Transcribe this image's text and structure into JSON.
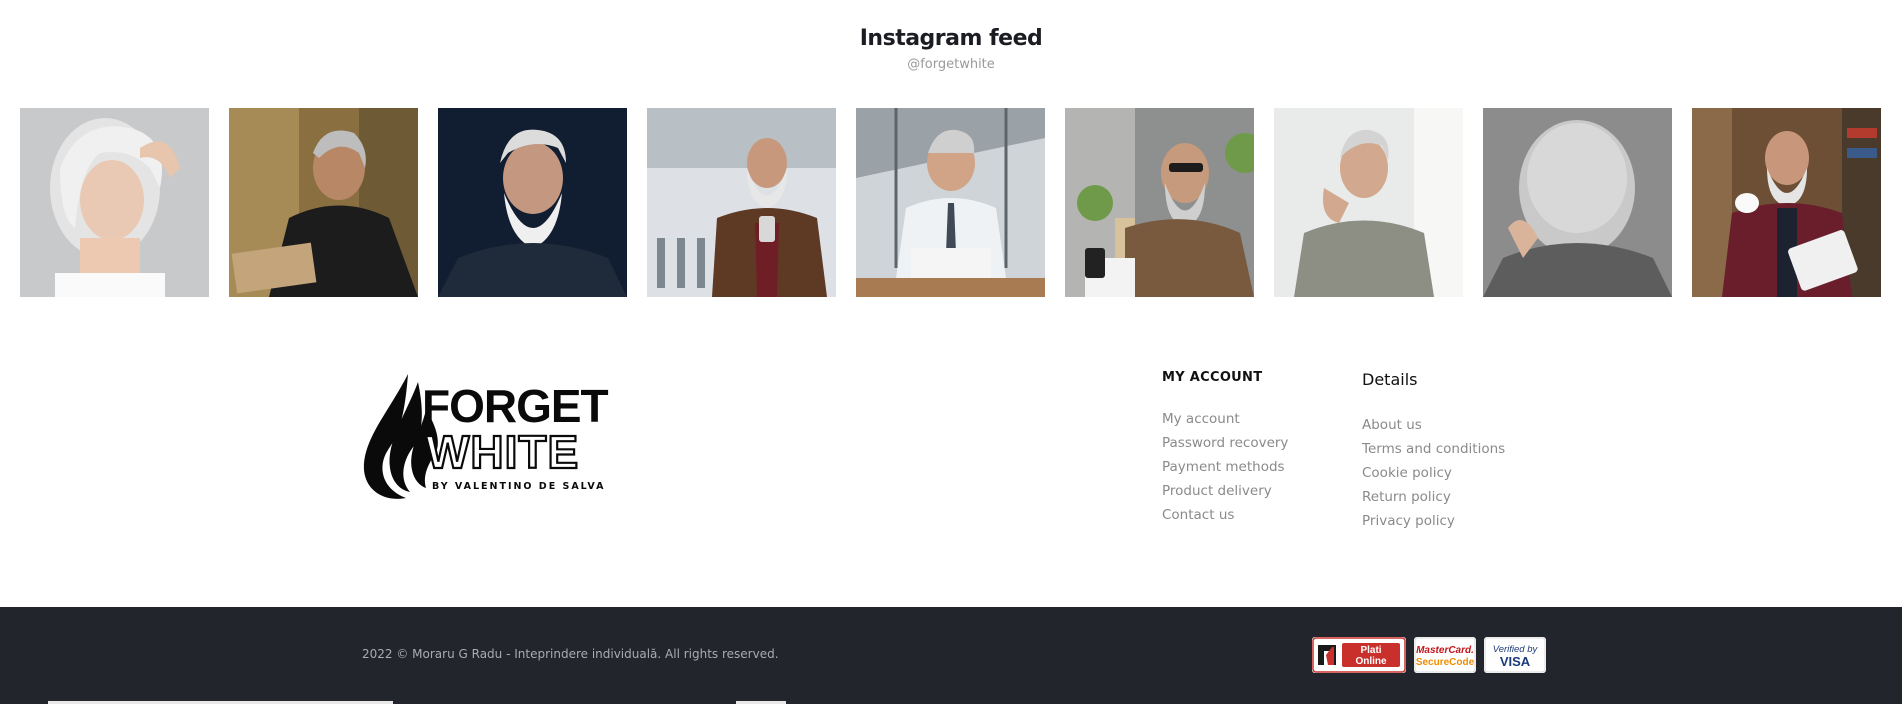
{
  "instagram": {
    "title": "Instagram feed",
    "handle": "@forgetwhite",
    "posts": [
      {
        "name": "post-1",
        "description_icon": "photo-icon"
      },
      {
        "name": "post-2",
        "description_icon": "photo-icon"
      },
      {
        "name": "post-3",
        "description_icon": "photo-icon"
      },
      {
        "name": "post-4",
        "description_icon": "photo-icon"
      },
      {
        "name": "post-5",
        "description_icon": "photo-icon"
      },
      {
        "name": "post-6",
        "description_icon": "photo-icon"
      },
      {
        "name": "post-7",
        "description_icon": "photo-icon"
      },
      {
        "name": "post-8",
        "description_icon": "photo-icon"
      },
      {
        "name": "post-9",
        "description_icon": "photo-icon"
      }
    ]
  },
  "logo": {
    "line1": "FORGET",
    "line2": "WHITE",
    "tagline": "BY VALENTINO DE SALVA"
  },
  "my_account": {
    "title": "MY ACCOUNT",
    "links": [
      "My account",
      "Password recovery",
      "Payment methods",
      "Product delivery",
      "Contact us"
    ]
  },
  "details": {
    "title": "Details",
    "links": [
      "About us",
      "Terms and conditions",
      "Cookie policy",
      "Return policy",
      "Privacy policy"
    ]
  },
  "footer": {
    "copyright": "2022 © Moraru G Radu - Inteprindere individuală. All rights reserved.",
    "badges": {
      "plati_line1": "Plati",
      "plati_line2": "Online",
      "mc_line1": "MasterCard.",
      "mc_line2": "SecureCode",
      "visa_line1": "Verified by",
      "visa_line2": "VISA"
    }
  },
  "colors": {
    "footer_bg": "#22252b",
    "link_gray": "#8a8a8a",
    "title_dark": "#1c1d22"
  }
}
